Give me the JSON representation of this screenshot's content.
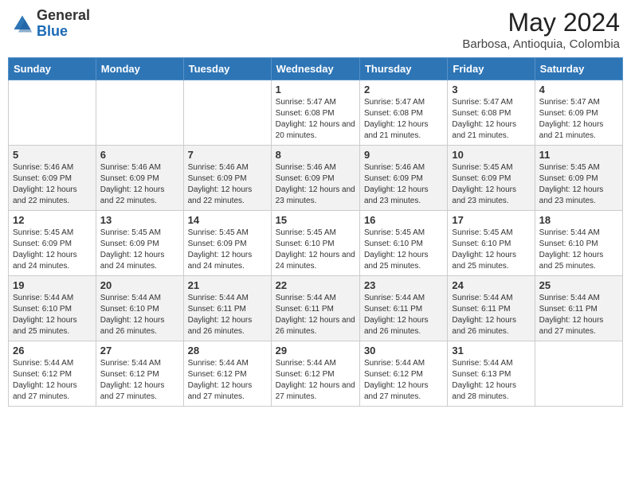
{
  "header": {
    "logo_general": "General",
    "logo_blue": "Blue",
    "month_year": "May 2024",
    "location": "Barbosa, Antioquia, Colombia"
  },
  "weekdays": [
    "Sunday",
    "Monday",
    "Tuesday",
    "Wednesday",
    "Thursday",
    "Friday",
    "Saturday"
  ],
  "weeks": [
    [
      {
        "day": null,
        "info": null
      },
      {
        "day": null,
        "info": null
      },
      {
        "day": null,
        "info": null
      },
      {
        "day": "1",
        "info": "Sunrise: 5:47 AM\nSunset: 6:08 PM\nDaylight: 12 hours and 20 minutes."
      },
      {
        "day": "2",
        "info": "Sunrise: 5:47 AM\nSunset: 6:08 PM\nDaylight: 12 hours and 21 minutes."
      },
      {
        "day": "3",
        "info": "Sunrise: 5:47 AM\nSunset: 6:08 PM\nDaylight: 12 hours and 21 minutes."
      },
      {
        "day": "4",
        "info": "Sunrise: 5:47 AM\nSunset: 6:09 PM\nDaylight: 12 hours and 21 minutes."
      }
    ],
    [
      {
        "day": "5",
        "info": "Sunrise: 5:46 AM\nSunset: 6:09 PM\nDaylight: 12 hours and 22 minutes."
      },
      {
        "day": "6",
        "info": "Sunrise: 5:46 AM\nSunset: 6:09 PM\nDaylight: 12 hours and 22 minutes."
      },
      {
        "day": "7",
        "info": "Sunrise: 5:46 AM\nSunset: 6:09 PM\nDaylight: 12 hours and 22 minutes."
      },
      {
        "day": "8",
        "info": "Sunrise: 5:46 AM\nSunset: 6:09 PM\nDaylight: 12 hours and 23 minutes."
      },
      {
        "day": "9",
        "info": "Sunrise: 5:46 AM\nSunset: 6:09 PM\nDaylight: 12 hours and 23 minutes."
      },
      {
        "day": "10",
        "info": "Sunrise: 5:45 AM\nSunset: 6:09 PM\nDaylight: 12 hours and 23 minutes."
      },
      {
        "day": "11",
        "info": "Sunrise: 5:45 AM\nSunset: 6:09 PM\nDaylight: 12 hours and 23 minutes."
      }
    ],
    [
      {
        "day": "12",
        "info": "Sunrise: 5:45 AM\nSunset: 6:09 PM\nDaylight: 12 hours and 24 minutes."
      },
      {
        "day": "13",
        "info": "Sunrise: 5:45 AM\nSunset: 6:09 PM\nDaylight: 12 hours and 24 minutes."
      },
      {
        "day": "14",
        "info": "Sunrise: 5:45 AM\nSunset: 6:09 PM\nDaylight: 12 hours and 24 minutes."
      },
      {
        "day": "15",
        "info": "Sunrise: 5:45 AM\nSunset: 6:10 PM\nDaylight: 12 hours and 24 minutes."
      },
      {
        "day": "16",
        "info": "Sunrise: 5:45 AM\nSunset: 6:10 PM\nDaylight: 12 hours and 25 minutes."
      },
      {
        "day": "17",
        "info": "Sunrise: 5:45 AM\nSunset: 6:10 PM\nDaylight: 12 hours and 25 minutes."
      },
      {
        "day": "18",
        "info": "Sunrise: 5:44 AM\nSunset: 6:10 PM\nDaylight: 12 hours and 25 minutes."
      }
    ],
    [
      {
        "day": "19",
        "info": "Sunrise: 5:44 AM\nSunset: 6:10 PM\nDaylight: 12 hours and 25 minutes."
      },
      {
        "day": "20",
        "info": "Sunrise: 5:44 AM\nSunset: 6:10 PM\nDaylight: 12 hours and 26 minutes."
      },
      {
        "day": "21",
        "info": "Sunrise: 5:44 AM\nSunset: 6:11 PM\nDaylight: 12 hours and 26 minutes."
      },
      {
        "day": "22",
        "info": "Sunrise: 5:44 AM\nSunset: 6:11 PM\nDaylight: 12 hours and 26 minutes."
      },
      {
        "day": "23",
        "info": "Sunrise: 5:44 AM\nSunset: 6:11 PM\nDaylight: 12 hours and 26 minutes."
      },
      {
        "day": "24",
        "info": "Sunrise: 5:44 AM\nSunset: 6:11 PM\nDaylight: 12 hours and 26 minutes."
      },
      {
        "day": "25",
        "info": "Sunrise: 5:44 AM\nSunset: 6:11 PM\nDaylight: 12 hours and 27 minutes."
      }
    ],
    [
      {
        "day": "26",
        "info": "Sunrise: 5:44 AM\nSunset: 6:12 PM\nDaylight: 12 hours and 27 minutes."
      },
      {
        "day": "27",
        "info": "Sunrise: 5:44 AM\nSunset: 6:12 PM\nDaylight: 12 hours and 27 minutes."
      },
      {
        "day": "28",
        "info": "Sunrise: 5:44 AM\nSunset: 6:12 PM\nDaylight: 12 hours and 27 minutes."
      },
      {
        "day": "29",
        "info": "Sunrise: 5:44 AM\nSunset: 6:12 PM\nDaylight: 12 hours and 27 minutes."
      },
      {
        "day": "30",
        "info": "Sunrise: 5:44 AM\nSunset: 6:12 PM\nDaylight: 12 hours and 27 minutes."
      },
      {
        "day": "31",
        "info": "Sunrise: 5:44 AM\nSunset: 6:13 PM\nDaylight: 12 hours and 28 minutes."
      },
      {
        "day": null,
        "info": null
      }
    ]
  ]
}
